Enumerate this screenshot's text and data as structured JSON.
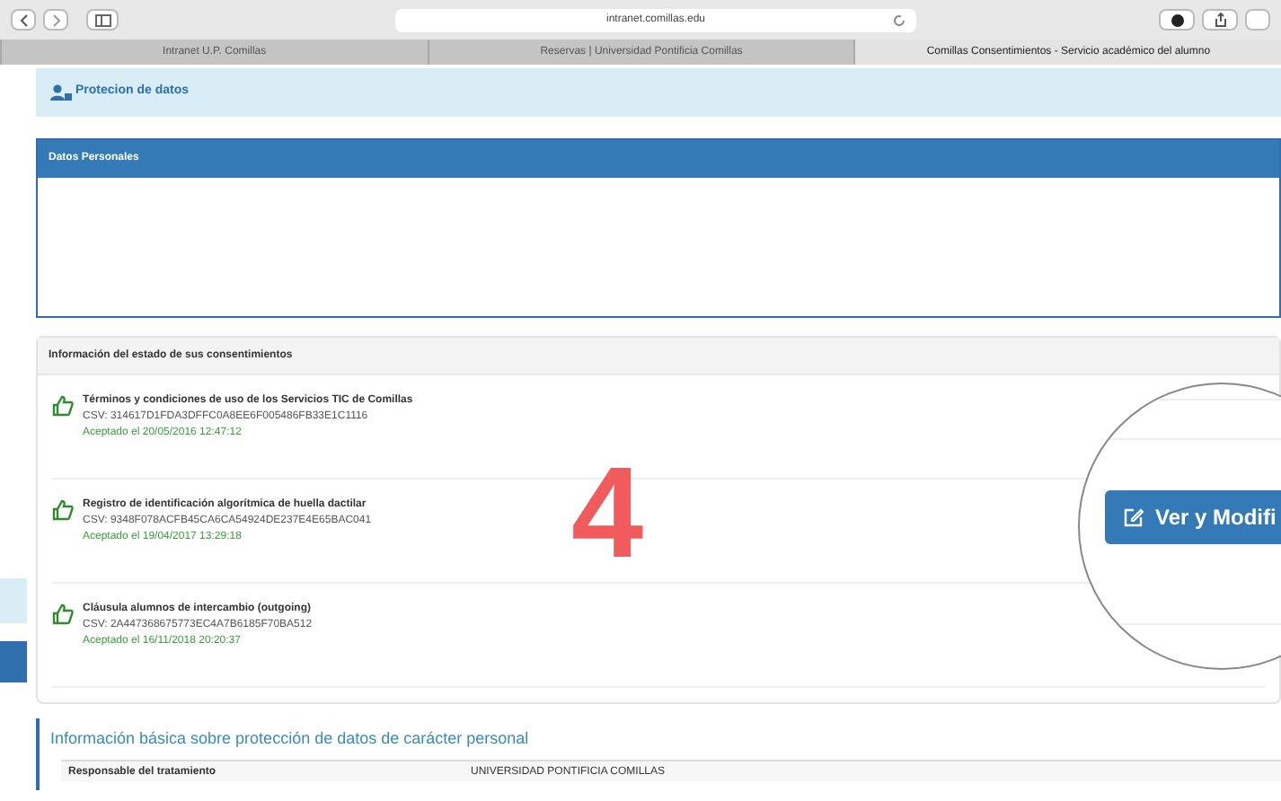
{
  "browser": {
    "address": "intranet.comillas.edu",
    "tabs": [
      {
        "label": "Intranet U.P. Comillas",
        "selected": false
      },
      {
        "label": "Reservas | Universidad Pontificia Comillas",
        "selected": false
      },
      {
        "label": "Comillas Consentimientos - Servicio académico del alumno",
        "selected": true
      }
    ]
  },
  "page_header": {
    "title": "Protecion de datos"
  },
  "personal_panel": {
    "title": "Datos Personales"
  },
  "consents_panel": {
    "title": "Información del estado de sus consentimientos",
    "items": [
      {
        "title": "Términos y condiciones de uso de los Servicios TIC de Comillas",
        "csv": "CSV: 314617D1FDA3DFFC0A8EE6F005486FB33E1C1116",
        "accepted": "Aceptado el 20/05/2016 12:47:12"
      },
      {
        "title": "Registro de identificación algorítmica de huella dactilar",
        "csv": "CSV: 9348F078ACFB45CA6CA54924DE237E4E65BAC041",
        "accepted": "Aceptado el 19/04/2017 13:29:18"
      },
      {
        "title": "Cláusula alumnos de intercambio (outgoing)",
        "csv": "CSV: 2A447368675773EC4A7B6185F70BA512",
        "accepted": "Aceptado el 16/11/2018 20:20:37"
      }
    ]
  },
  "magnifier": {
    "button": "Ver y Modifi"
  },
  "step_number": "4",
  "info_section": {
    "title": "Información básica sobre protección de datos de carácter personal",
    "rows": [
      {
        "label": "Responsable del tratamiento",
        "value": "UNIVERSIDAD PONTIFICIA COMILLAS"
      }
    ]
  }
}
